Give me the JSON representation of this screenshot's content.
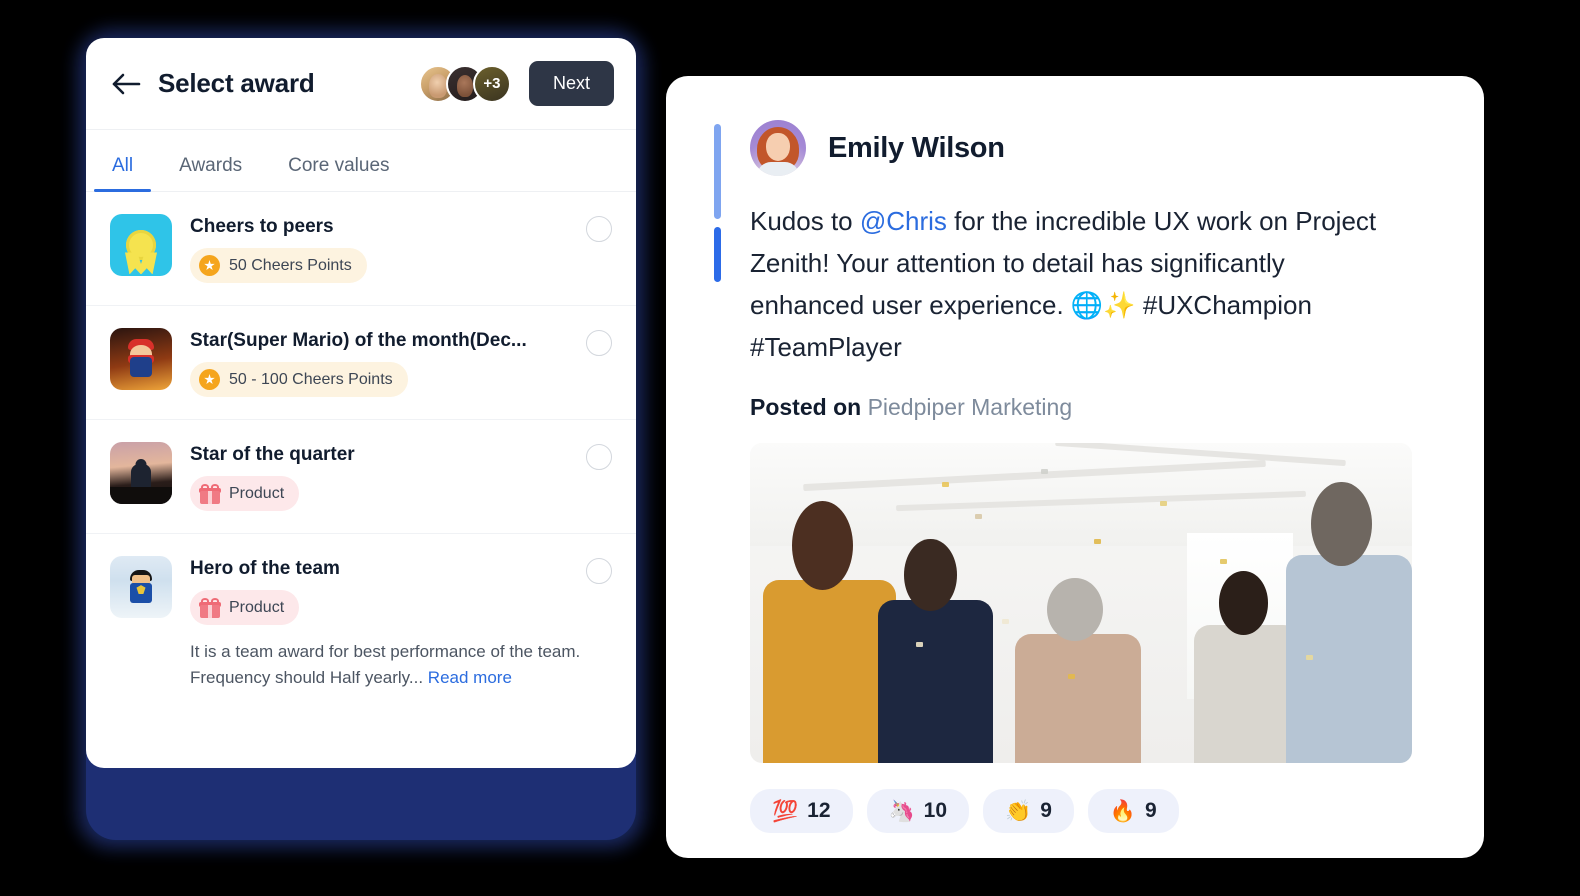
{
  "left_panel": {
    "back_icon": "arrow-left-icon",
    "title": "Select award",
    "avatar_overflow": "+3",
    "next_label": "Next",
    "tabs": [
      {
        "label": "All",
        "active": true
      },
      {
        "label": "Awards",
        "active": false
      },
      {
        "label": "Core values",
        "active": false
      }
    ],
    "awards": [
      {
        "name": "Cheers to peers",
        "thumb": "medal-badge-thumbnail",
        "pill_type": "points",
        "pill_label": "50 Cheers Points",
        "pill_icon": "star-icon",
        "description": "",
        "read_more": "",
        "selected": false
      },
      {
        "name": "Star(Super Mario) of the month(Dec...",
        "thumb": "super-mario-thumbnail",
        "pill_type": "points",
        "pill_label": "50 - 100 Cheers Points",
        "pill_icon": "star-icon",
        "description": "",
        "read_more": "",
        "selected": false
      },
      {
        "name": "Star of the quarter",
        "thumb": "superhero-silhouette-thumbnail",
        "pill_type": "product",
        "pill_label": "Product",
        "pill_icon": "gift-icon",
        "description": "",
        "read_more": "",
        "selected": false
      },
      {
        "name": "Hero of the team",
        "thumb": "superman-lego-thumbnail",
        "pill_type": "product",
        "pill_label": "Product",
        "pill_icon": "gift-icon",
        "description": "It is a team award for best performance of the team. Frequency should Half yearly... ",
        "read_more": "Read more",
        "selected": false
      }
    ]
  },
  "right_panel": {
    "author": "Emily Wilson",
    "avatar": "emily-wilson-avatar",
    "post_text_1": "Kudos to ",
    "mention": "@Chris",
    "post_text_2": " for the incredible UX work on Project Zenith! Your attention to detail has significantly enhanced user experience. 🌐✨ #UXChampion #TeamPlayer",
    "posted_on_label": "Posted on ",
    "posted_on_org": "Piedpiper Marketing",
    "photo_alt": "team-celebration-photo",
    "reactions": [
      {
        "emoji": "💯",
        "name": "hundred-points-emoji",
        "count": "12"
      },
      {
        "emoji": "🦄",
        "name": "unicorn-emoji",
        "count": "10"
      },
      {
        "emoji": "👏",
        "name": "clapping-hands-emoji",
        "count": "9"
      },
      {
        "emoji": "🔥",
        "name": "fire-emoji",
        "count": "9"
      }
    ]
  },
  "colors": {
    "accent_blue": "#2b6cdf",
    "accent_light_blue": "#7fa5f0",
    "next_button": "#2e3646",
    "points_pill_bg": "#fdf3e0",
    "product_pill_bg": "#fde8ea",
    "reaction_pill_bg": "#eef1fb",
    "background": "#000000",
    "card_shadow": "#1e2f74"
  }
}
